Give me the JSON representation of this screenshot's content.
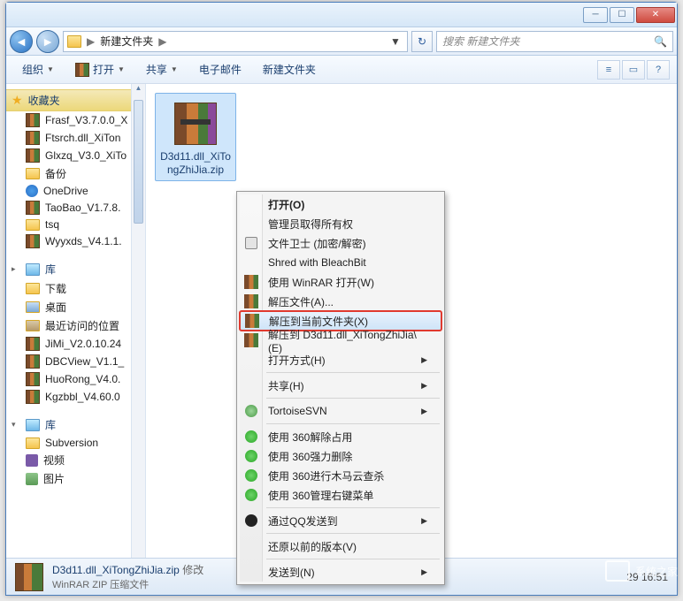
{
  "window_controls": {
    "min": "─",
    "max": "☐",
    "close": "✕"
  },
  "nav": {
    "back": "◄",
    "forward": "►",
    "refresh": "↻"
  },
  "breadcrumb": {
    "item1": "新建文件夹",
    "sep": "▶"
  },
  "search": {
    "placeholder": "搜索 新建文件夹",
    "icon": "🔍"
  },
  "toolbar": {
    "organize": "组织",
    "open": "打开",
    "share": "共享",
    "email": "电子邮件",
    "newfolder": "新建文件夹",
    "dd": "▼",
    "view": "≡",
    "preview": "▭",
    "help": "?"
  },
  "sidebar": {
    "favorites_hdr": "收藏夹",
    "items": [
      "Frasf_V3.7.0.0_X",
      "Ftsrch.dll_XiTon",
      "Glxzq_V3.0_XiTo",
      "备份",
      "OneDrive",
      "TaoBao_V1.7.8.",
      "tsq",
      "Wyyxds_V4.1.1."
    ],
    "lib_hdr": "库",
    "lib_items": [
      "下载",
      "桌面",
      "最近访问的位置",
      "JiMi_V2.0.10.24",
      "DBCView_V1.1_",
      "HuoRong_V4.0.",
      "Kgzbbl_V4.60.0"
    ],
    "lib2_hdr": "库",
    "lib2_items": [
      "Subversion",
      "视频",
      "图片"
    ]
  },
  "file": {
    "name": "D3d11.dll_XiTongZhiJia.zip"
  },
  "context_menu": {
    "open": "打开(O)",
    "admin": "管理员取得所有权",
    "guard": "文件卫士 (加密/解密)",
    "shred": "Shred with BleachBit",
    "winrar_open": "使用 WinRAR 打开(W)",
    "extract_a": "解压文件(A)...",
    "extract_here": "解压到当前文件夹(X)",
    "extract_to": "解压到 D3d11.dll_XiTongZhiJia\\(E)",
    "open_with": "打开方式(H)",
    "share": "共享(H)",
    "tortoise": "TortoiseSVN",
    "360_unlock": "使用 360解除占用",
    "360_delete": "使用 360强力删除",
    "360_scan": "使用 360进行木马云查杀",
    "360_menu": "使用 360管理右键菜单",
    "qq_send": "通过QQ发送到",
    "restore": "还原以前的版本(V)",
    "send_to": "发送到(N)"
  },
  "status": {
    "title": "D3d11.dll_XiTongZhiJia.zip",
    "modlabel": "修改",
    "type": "WinRAR ZIP 压缩文件",
    "date": "29 16:51"
  },
  "watermark": {
    "text": "系统之家",
    "sub": "XITONGZHIJIA"
  }
}
